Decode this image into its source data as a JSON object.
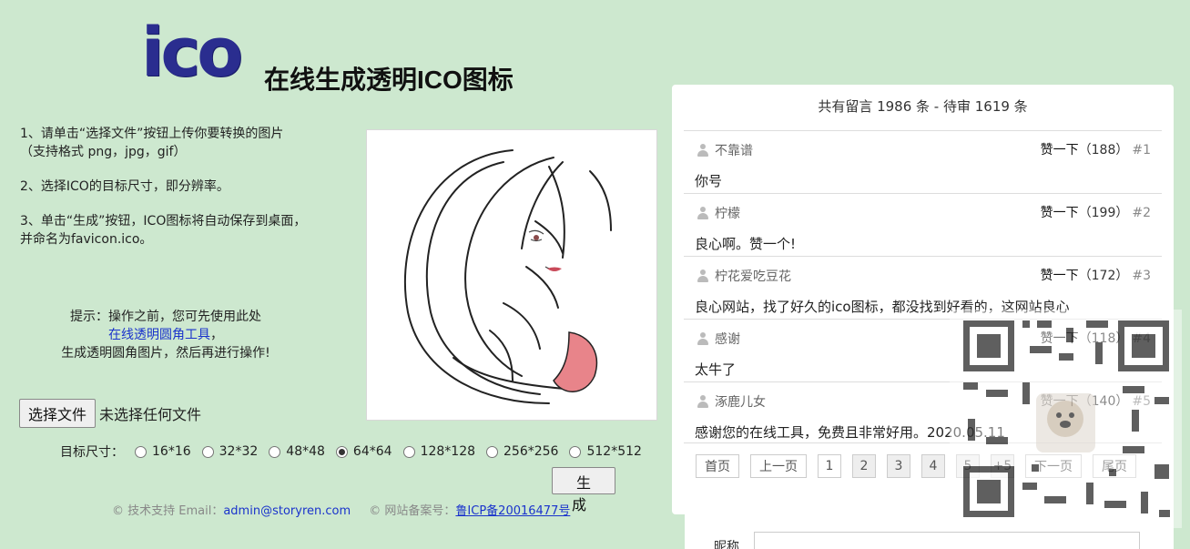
{
  "header": {
    "logo_text": "ico",
    "title": "在线生成透明ICO图标"
  },
  "instructions": {
    "step1_line1": "1、请单击“选择文件”按钮上传你要转换的图片",
    "step1_line2": "（支持格式 png，jpg，gif）",
    "step2": "2、选择ICO的目标尺寸，即分辨率。",
    "step3_line1": "3、单击“生成”按钮，ICO图标将自动保存到桌面，",
    "step3_line2": "并命名为favicon.ico。"
  },
  "tip": {
    "line1": "提示：操作之前，您可先使用此处",
    "link": "在线透明圆角工具",
    "link_suffix": "，",
    "line3": "生成透明圆角图片，然后再进行操作!"
  },
  "file": {
    "button_label": "选择文件",
    "status": "未选择任何文件"
  },
  "size": {
    "label": "目标尺寸：",
    "options": [
      "16*16",
      "32*32",
      "48*48",
      "64*64",
      "128*128",
      "256*256",
      "512*512"
    ],
    "selected": "64*64"
  },
  "generate_label": "生 成",
  "footer": {
    "support_prefix": "© 技术支持 Email：",
    "email": "admin@storyren.com",
    "icp_prefix": "© 网站备案号：",
    "icp": "鲁ICP备20016477号"
  },
  "comments": {
    "summary": "共有留言 1986 条 - 待审 1619 条",
    "like_label": "赞一下",
    "items": [
      {
        "user": "不靠谱",
        "count": "（188）",
        "index": "#1",
        "text": "你号"
      },
      {
        "user": "柠檬",
        "count": "（199）",
        "index": "#2",
        "text": "良心啊。赞一个!"
      },
      {
        "user": "柠花爱吃豆花",
        "count": "（172）",
        "index": "#3",
        "text": "良心网站，找了好久的ico图标，都没找到好看的，这网站良心"
      },
      {
        "user": "感谢",
        "count": "（118）",
        "index": "#4",
        "text": "太牛了"
      },
      {
        "user": "涿鹿儿女",
        "count": "（140）",
        "index": "#5",
        "text": "感谢您的在线工具，免费且非常好用。2020.05.11"
      }
    ],
    "pager": {
      "first": "首页",
      "prev": "上一页",
      "pages": [
        "1",
        "2",
        "3",
        "4",
        "5"
      ],
      "current": "1",
      "more": "+5",
      "next": "下一页",
      "last": "尾页"
    }
  },
  "nickname_label": "昵称"
}
